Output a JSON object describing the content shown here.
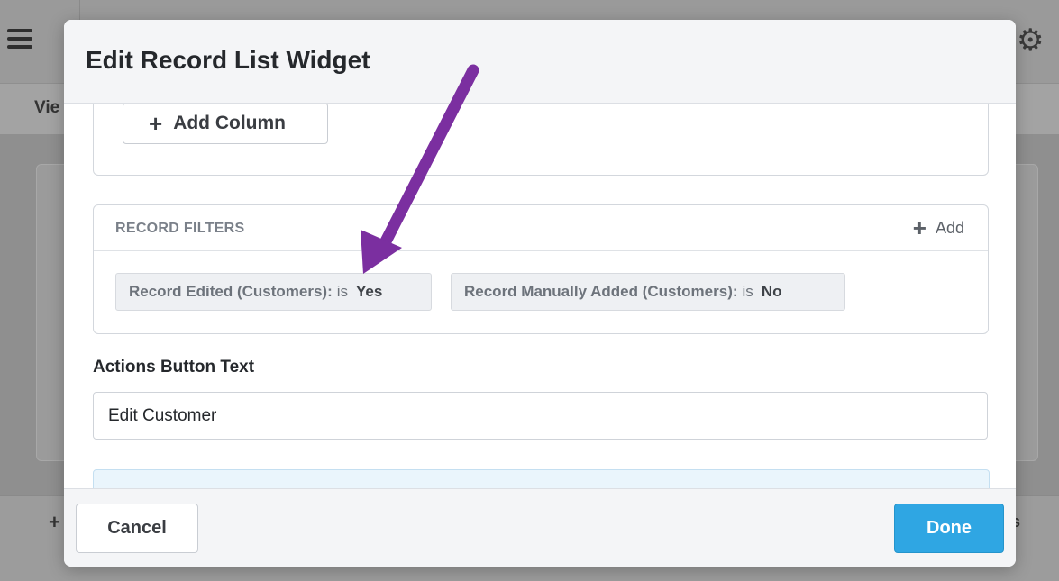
{
  "background": {
    "view_tab_label": "Vie"
  },
  "modal": {
    "title": "Edit Record List Widget",
    "columns": {
      "add_column_label": "Add Column"
    },
    "record_filters": {
      "title": "RECORD FILTERS",
      "add_label": "Add",
      "filters": [
        {
          "field": "Record Edited (Customers):",
          "operator": "is",
          "value": "Yes"
        },
        {
          "field": "Record Manually Added (Customers):",
          "operator": "is",
          "value": "No"
        }
      ]
    },
    "actions_button_text": {
      "label": "Actions Button Text",
      "value": "Edit Customer"
    },
    "footer": {
      "cancel_label": "Cancel",
      "done_label": "Done"
    }
  },
  "annotation": {
    "arrow_color": "#7b2fa0"
  },
  "colors": {
    "primary_button": "#2fa6e3",
    "info_panel": "#eaf5fc"
  }
}
